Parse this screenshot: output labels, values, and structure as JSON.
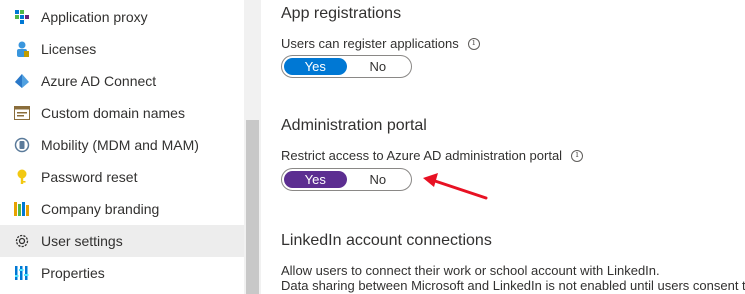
{
  "sidebar": {
    "items": [
      {
        "label": "Application proxy",
        "icon": "application-proxy-icon"
      },
      {
        "label": "Licenses",
        "icon": "licenses-icon"
      },
      {
        "label": "Azure AD Connect",
        "icon": "azure-ad-connect-icon"
      },
      {
        "label": "Custom domain names",
        "icon": "custom-domain-icon"
      },
      {
        "label": "Mobility (MDM and MAM)",
        "icon": "mobility-icon"
      },
      {
        "label": "Password reset",
        "icon": "key-icon"
      },
      {
        "label": "Company branding",
        "icon": "company-branding-icon"
      },
      {
        "label": "User settings",
        "icon": "gear-icon",
        "selected": true
      },
      {
        "label": "Properties",
        "icon": "properties-icon"
      }
    ]
  },
  "main": {
    "app_registrations": {
      "title": "App registrations",
      "label": "Users can register applications",
      "yes": "Yes",
      "no": "No",
      "selected": "Yes"
    },
    "admin_portal": {
      "title": "Administration portal",
      "label": "Restrict access to Azure AD administration portal",
      "yes": "Yes",
      "no": "No",
      "selected": "Yes"
    },
    "linkedin": {
      "title": "LinkedIn account connections",
      "line1": "Allow users to connect their work or school account with LinkedIn.",
      "line2": "Data sharing between Microsoft and LinkedIn is not enabled until users consent t"
    }
  },
  "colors": {
    "toggle_blue": "#0078d4",
    "toggle_purple": "#5c2e91",
    "annotation_arrow": "#e81123"
  }
}
